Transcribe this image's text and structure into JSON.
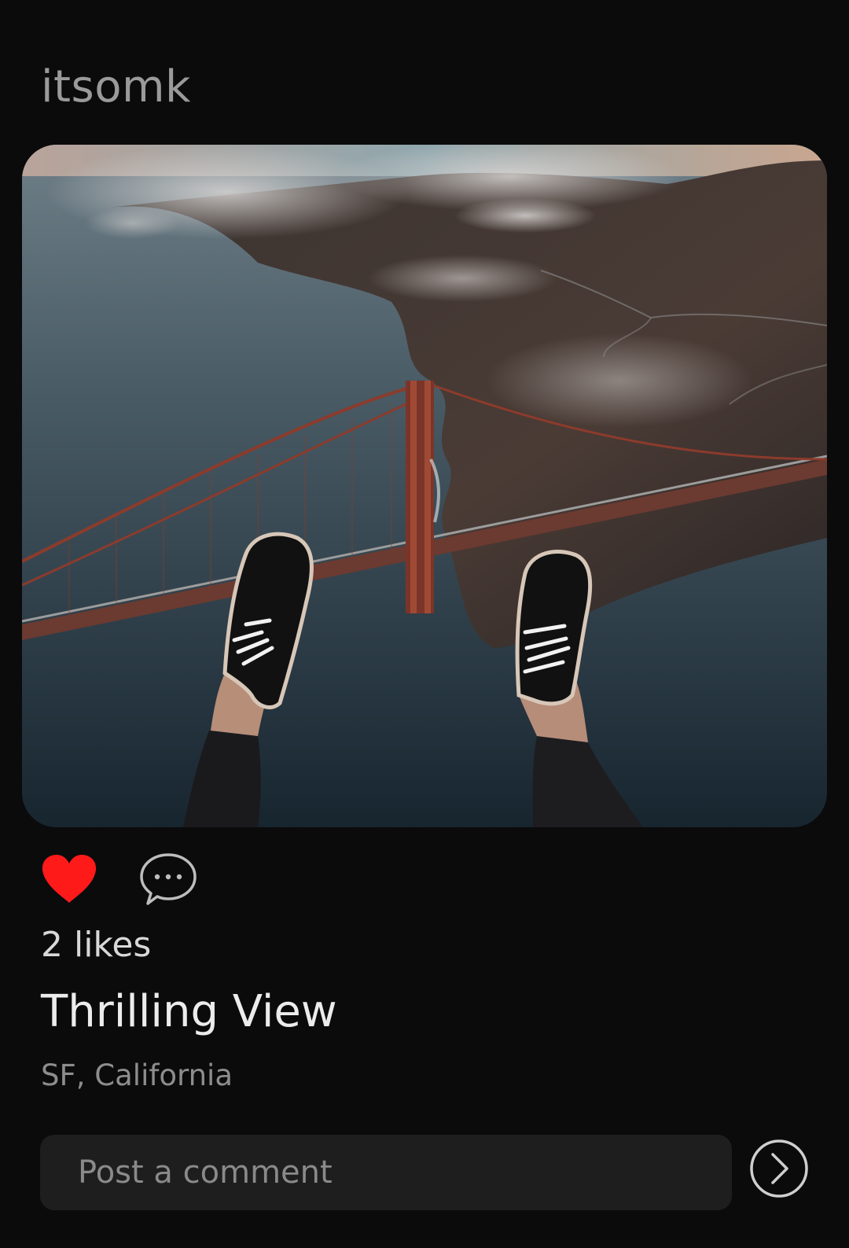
{
  "post": {
    "username": "itsomk",
    "photo_icon": "photo-golden-gate-bridge-feet",
    "liked": true,
    "likes_text": "2 likes",
    "caption": "Thrilling View",
    "location": "SF, California"
  },
  "comment": {
    "placeholder": "Post a comment",
    "value": ""
  },
  "icons": {
    "like": "heart-icon",
    "comment": "speech-bubble-icon",
    "send": "chevron-right-circle-icon"
  },
  "colors": {
    "background": "#0b0b0c",
    "like_active": "#ff1a1a",
    "input_bg": "#1e1e1f",
    "muted_text": "#8d8d8d"
  }
}
